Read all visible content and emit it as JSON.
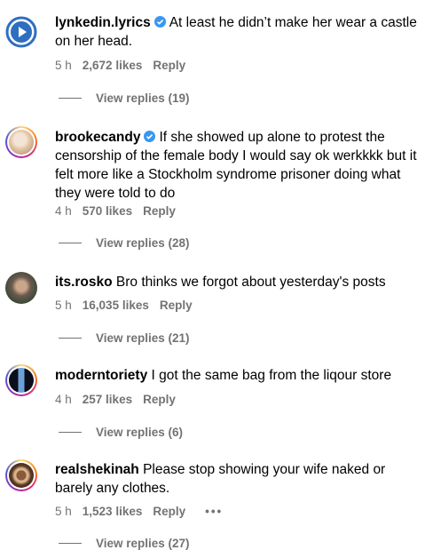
{
  "comments": [
    {
      "username": "lynkedin.lyrics",
      "verified": true,
      "text": "At least he didn’t make her wear a castle on her head.",
      "time": "5 h",
      "likes": "2,672 likes",
      "reply": "Reply",
      "view_replies": "View replies (19)",
      "avatar_icon": "play-button-icon",
      "avatar_color": "#2e6ec0"
    },
    {
      "username": "brookecandy",
      "verified": true,
      "text": "If she showed up alone to protest the censorship of the female body I would say ok werkkkk but it felt more like a Stockholm syndrome prisoner doing what they were told to do",
      "time": "4 h",
      "likes": "570 likes",
      "reply": "Reply",
      "view_replies": "View replies (28)"
    },
    {
      "username": "its.rosko",
      "verified": false,
      "text": "Bro thinks we forgot about yesterday's posts",
      "time": "5 h",
      "likes": "16,035 likes",
      "reply": "Reply",
      "view_replies": "View replies (21)"
    },
    {
      "username": "moderntoriety",
      "verified": false,
      "text": "I got the same bag from the liqour store",
      "time": "4 h",
      "likes": "257 likes",
      "reply": "Reply",
      "view_replies": "View replies (6)"
    },
    {
      "username": "realshekinah",
      "verified": false,
      "text": "Please stop showing your wife naked or barely any clothes.",
      "time": "5 h",
      "likes": "1,523 likes",
      "reply": "Reply",
      "more": "•••",
      "view_replies": "View replies (27)"
    }
  ],
  "colors": {
    "verified": "#3897f0",
    "meta_text": "#737373"
  }
}
